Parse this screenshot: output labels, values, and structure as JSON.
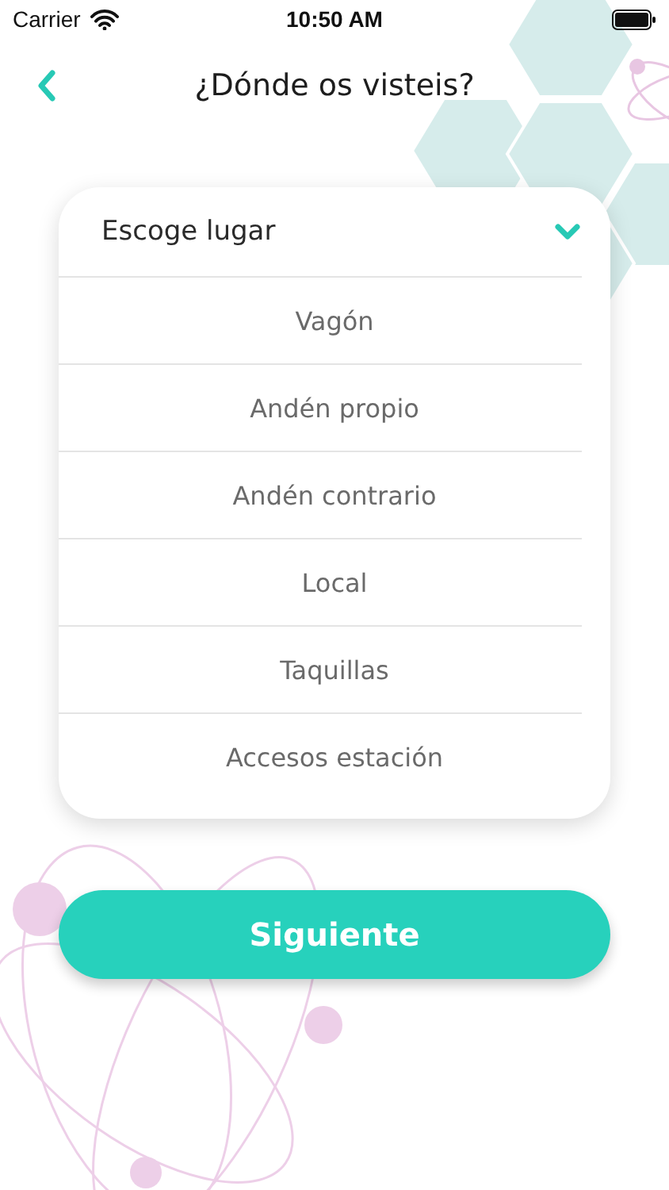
{
  "status_bar": {
    "carrier": "Carrier",
    "time": "10:50 AM"
  },
  "header": {
    "title": "¿Dónde os visteis?"
  },
  "dropdown": {
    "placeholder": "Escoge lugar",
    "options": [
      "Vagón",
      "Andén propio",
      "Andén contrario",
      "Local",
      "Taquillas",
      "Accesos estación"
    ]
  },
  "next_button": {
    "label": "Siguiente"
  }
}
